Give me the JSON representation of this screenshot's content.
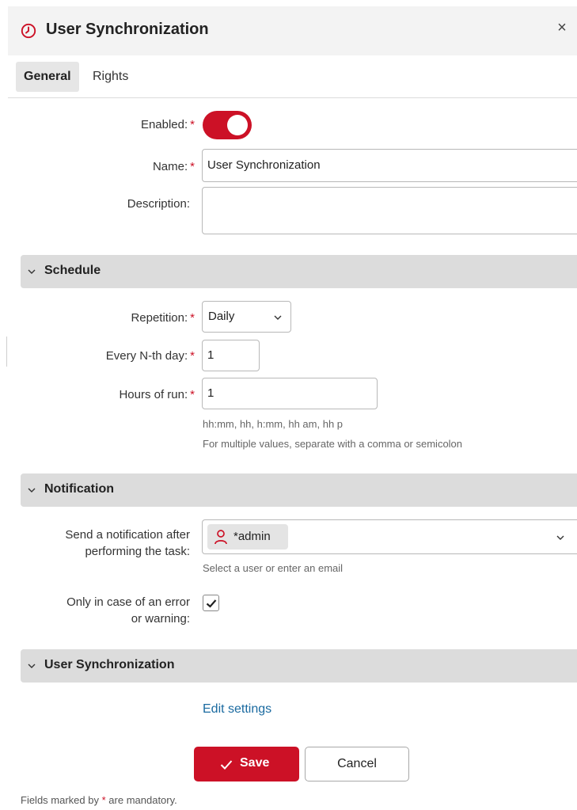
{
  "dialog": {
    "title": "User Synchronization",
    "close_symbol": "×",
    "title_icon": "clock-icon"
  },
  "tabs": [
    {
      "label": "General",
      "active": true
    },
    {
      "label": "Rights",
      "active": false
    }
  ],
  "form": {
    "required_mark": "*",
    "enabled": {
      "label": "Enabled:",
      "value": true
    },
    "name": {
      "label": "Name:",
      "value": "User Synchronization"
    },
    "description": {
      "label": "Description:",
      "value": ""
    }
  },
  "schedule": {
    "title": "Schedule",
    "repetition": {
      "label": "Repetition:",
      "value": "Daily"
    },
    "every_nth_day": {
      "label": "Every N-th day:",
      "value": "1"
    },
    "hours_of_run": {
      "label": "Hours of run:",
      "value": "1",
      "hint_formats": "hh:mm, hh, h:mm, hh am, hh p",
      "hint_multiple": "For multiple values, separate with a comma or semicolon"
    }
  },
  "notification": {
    "title": "Notification",
    "send_label_line1": "Send a notification after",
    "send_label_line2": "performing the task:",
    "recipient": "*admin",
    "recipient_hint": "Select a user or enter an email",
    "error_only_line1": "Only in case of an error",
    "error_only_line2": "or warning:",
    "error_only_checked": true
  },
  "user_sync": {
    "title": "User Synchronization",
    "edit_link": "Edit settings"
  },
  "actions": {
    "save_label": "Save",
    "cancel_label": "Cancel"
  },
  "footer": {
    "prefix": "Fields marked by",
    "mark": "*",
    "suffix": "are mandatory."
  },
  "colors": {
    "accent": "#cc1126",
    "link": "#1a6aa0",
    "section_bg": "#dcdcdc"
  }
}
